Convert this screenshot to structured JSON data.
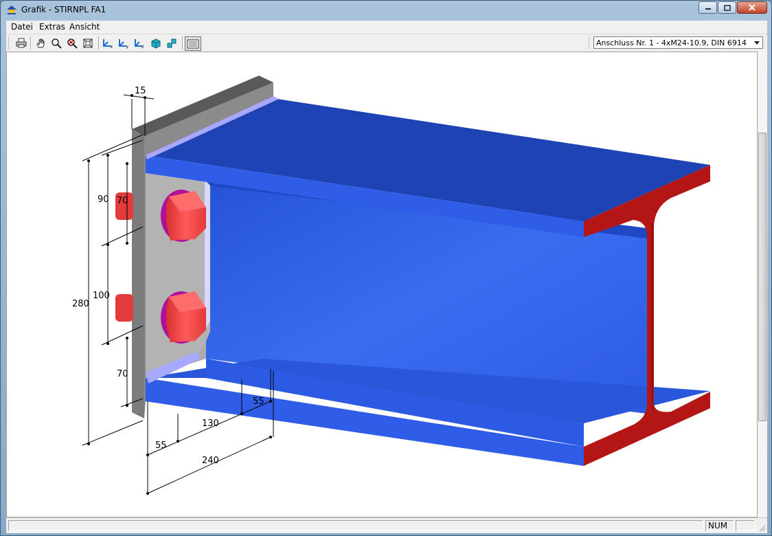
{
  "window": {
    "title": "Grafik - STIRNPL FA1"
  },
  "menu": [
    {
      "label": "Datei"
    },
    {
      "label": "Extras"
    },
    {
      "label": "Ansicht"
    }
  ],
  "toolbar": {
    "buttons": [
      {
        "icon": "print-icon"
      },
      {
        "icon": "pan-hand-icon"
      },
      {
        "icon": "zoom-icon"
      },
      {
        "icon": "zoom-reset-icon"
      },
      {
        "icon": "fit-view-icon"
      },
      {
        "icon": "view-x-icon"
      },
      {
        "icon": "view-y-icon"
      },
      {
        "icon": "view-z-icon"
      },
      {
        "icon": "view-iso-icon"
      },
      {
        "icon": "view-iso2-icon"
      },
      {
        "icon": "dimension-toggle-icon"
      }
    ],
    "connection_select": {
      "value": "Anschluss Nr. 1 - 4xM24-10.9, DIN 6914"
    }
  },
  "drawing": {
    "dimensions": {
      "plate_thickness": "15",
      "top_edge": "90",
      "bolt_row_1": "70",
      "bolt_spacing": "100",
      "plate_height": "280",
      "bottom_edge": "70",
      "length_1": "55",
      "length_2": "130",
      "length_3": "55",
      "length_total": "240"
    },
    "colors": {
      "beam": "#2f5de0",
      "beam_top": "#1e43b4",
      "section": "#b51414",
      "plate": "#a9a9a9",
      "bolt": "#ef4242"
    }
  },
  "status": {
    "num": "NUM"
  }
}
